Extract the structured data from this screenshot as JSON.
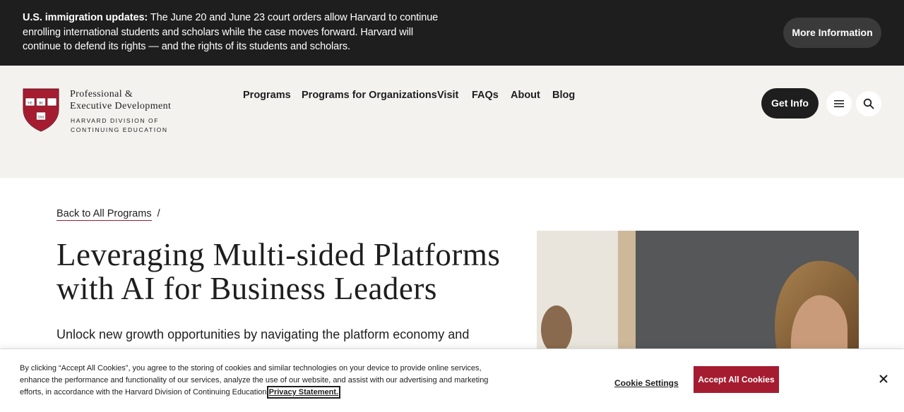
{
  "alert": {
    "label": "U.S. immigration updates:",
    "message": "The June 20 and June 23 court orders allow Harvard to continue enrolling international students and scholars while the case moves forward. Harvard will continue to defend its rights — and the rights of its students and scholars.",
    "button_label": "More Information"
  },
  "logo": {
    "line1": "Professional &",
    "line2": "Executive Development",
    "line3": "HARVARD DIVISION OF",
    "line4": "CONTINUING EDUCATION",
    "shield_text": [
      "VE",
      "RI",
      "TAS"
    ]
  },
  "nav": {
    "items": [
      "Programs",
      "Programs for Organizations",
      "Visit",
      "FAQs",
      "About",
      "Blog"
    ],
    "get_info_label": "Get Info",
    "menu_icon": "hamburger-icon",
    "search_icon": "search-icon"
  },
  "breadcrumb": {
    "link": "Back to All Programs",
    "separator": "/"
  },
  "page": {
    "title": "Leveraging Multi-sided Platforms with AI for Business Leaders",
    "lead": "Unlock new growth opportunities by navigating the platform economy and"
  },
  "cookie": {
    "text": "By clicking “Accept All Cookies”, you agree to the storing of cookies and similar technologies on your device to provide online services, enhance the performance and functionality of our services, analyze the use of our website, and assist with our advertising and marketing efforts, in accordance with the Harvard Division of Continuing Education",
    "privacy_link": "Privacy Statement.",
    "settings_label": "Cookie Settings",
    "accept_label": "Accept All Cookies",
    "close_icon": "close-icon"
  },
  "colors": {
    "dark": "#1e1e1e",
    "crimson": "#a51c30",
    "header_bg": "#f3f2ef"
  }
}
